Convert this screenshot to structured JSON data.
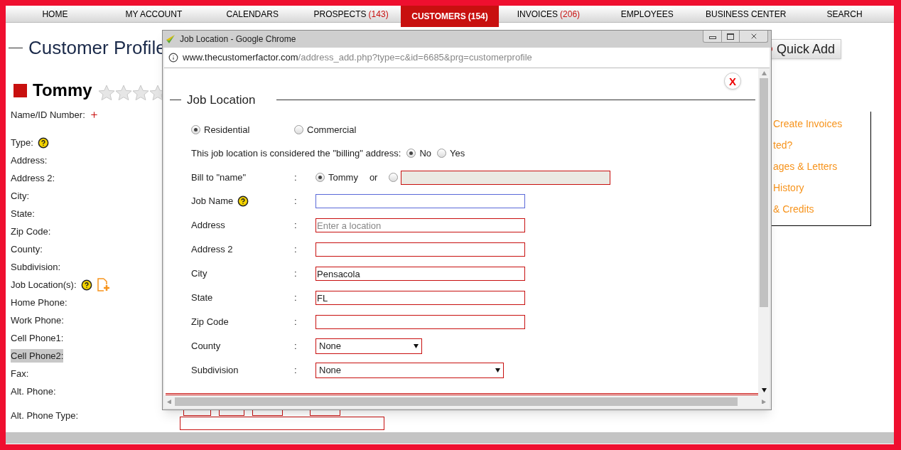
{
  "nav": [
    {
      "label": "HOME",
      "selected": false
    },
    {
      "label": "MY ACCOUNT",
      "selected": false
    },
    {
      "label": "CALENDARS",
      "selected": false
    },
    {
      "label": "PROSPECTS",
      "count": "(143)",
      "selected": false
    },
    {
      "label": "CUSTOMERS",
      "count": "(154)",
      "selected": true
    },
    {
      "label": "INVOICES",
      "count": "(206)",
      "selected": false
    },
    {
      "label": "EMPLOYEES",
      "selected": false
    },
    {
      "label": "BUSINESS CENTER",
      "selected": false
    },
    {
      "label": "SEARCH",
      "selected": false
    }
  ],
  "page": {
    "title": "Customer Profile",
    "customer_name": "Tommy",
    "stars": 0,
    "fields": [
      {
        "label": "Name/ID Number:",
        "kind": "plus",
        "highlighted": false
      },
      {
        "label": "Type:",
        "kind": "help",
        "highlighted": false
      },
      {
        "label": "Address:",
        "kind": "plain",
        "highlighted": false
      },
      {
        "label": "Address 2:",
        "kind": "plain",
        "highlighted": false
      },
      {
        "label": "City:",
        "kind": "plain",
        "highlighted": false
      },
      {
        "label": "State:",
        "kind": "plain",
        "highlighted": false
      },
      {
        "label": "Zip Code:",
        "kind": "plain",
        "highlighted": false
      },
      {
        "label": "County:",
        "kind": "plain",
        "highlighted": false
      },
      {
        "label": "Subdivision:",
        "kind": "plain",
        "highlighted": false
      },
      {
        "label": "Job Location(s):",
        "kind": "help-add",
        "highlighted": false
      },
      {
        "label": "Home Phone:",
        "kind": "plain",
        "highlighted": false
      },
      {
        "label": "Work Phone:",
        "kind": "plain",
        "highlighted": false
      },
      {
        "label": "Cell Phone1:",
        "kind": "plain",
        "highlighted": false
      },
      {
        "label": "Cell Phone2:",
        "kind": "plain",
        "highlighted": true
      },
      {
        "label": "Fax:",
        "kind": "plain",
        "highlighted": false
      },
      {
        "label": "Alt. Phone:",
        "kind": "plain",
        "highlighted": false
      },
      {
        "label": "Alt. Phone Type:",
        "kind": "plain",
        "highlighted": false
      }
    ],
    "quick_add": "Quick Add",
    "side_links": [
      "Create Invoices",
      "ted?",
      "ages & Letters",
      "History",
      "& Credits"
    ]
  },
  "popup": {
    "title": "Job Location - Google Chrome",
    "url_host": "www.thecustomerfactor.com",
    "url_path": "/address_add.php?type=c&id=6685&prg=customerprofile",
    "close": "X",
    "heading": "Job Location",
    "location_types": [
      {
        "label": "Residential",
        "selected": true
      },
      {
        "label": "Commercial",
        "selected": false
      }
    ],
    "billing_question": "This job location is considered the \"billing\" address:",
    "billing_options": [
      {
        "label": "No",
        "selected": true
      },
      {
        "label": "Yes",
        "selected": false
      }
    ],
    "bill_to": {
      "label": "Bill to \"name\"",
      "colon": ":",
      "name_option": {
        "label": "Tommy",
        "selected": true
      },
      "or": "or",
      "other_option": {
        "selected": false
      }
    },
    "fields": [
      {
        "label": "Job Name",
        "kind": "text",
        "help": true,
        "focused": true
      },
      {
        "label": "Address",
        "kind": "text",
        "placeholder": "Enter a location",
        "help": false,
        "focused": false
      },
      {
        "label": "Address 2",
        "kind": "text",
        "help": false,
        "focused": false
      },
      {
        "label": "City",
        "kind": "text",
        "value": "Pensacola",
        "help": false,
        "focused": false
      },
      {
        "label": "State",
        "kind": "text",
        "value": "FL",
        "help": false,
        "focused": false
      },
      {
        "label": "Zip Code",
        "kind": "text",
        "help": false,
        "focused": false
      },
      {
        "label": "County",
        "kind": "select",
        "value": "None",
        "help": false,
        "focused": false
      },
      {
        "label": "Subdivision",
        "kind": "select-wide",
        "value": "None",
        "help": false,
        "focused": false
      }
    ]
  }
}
